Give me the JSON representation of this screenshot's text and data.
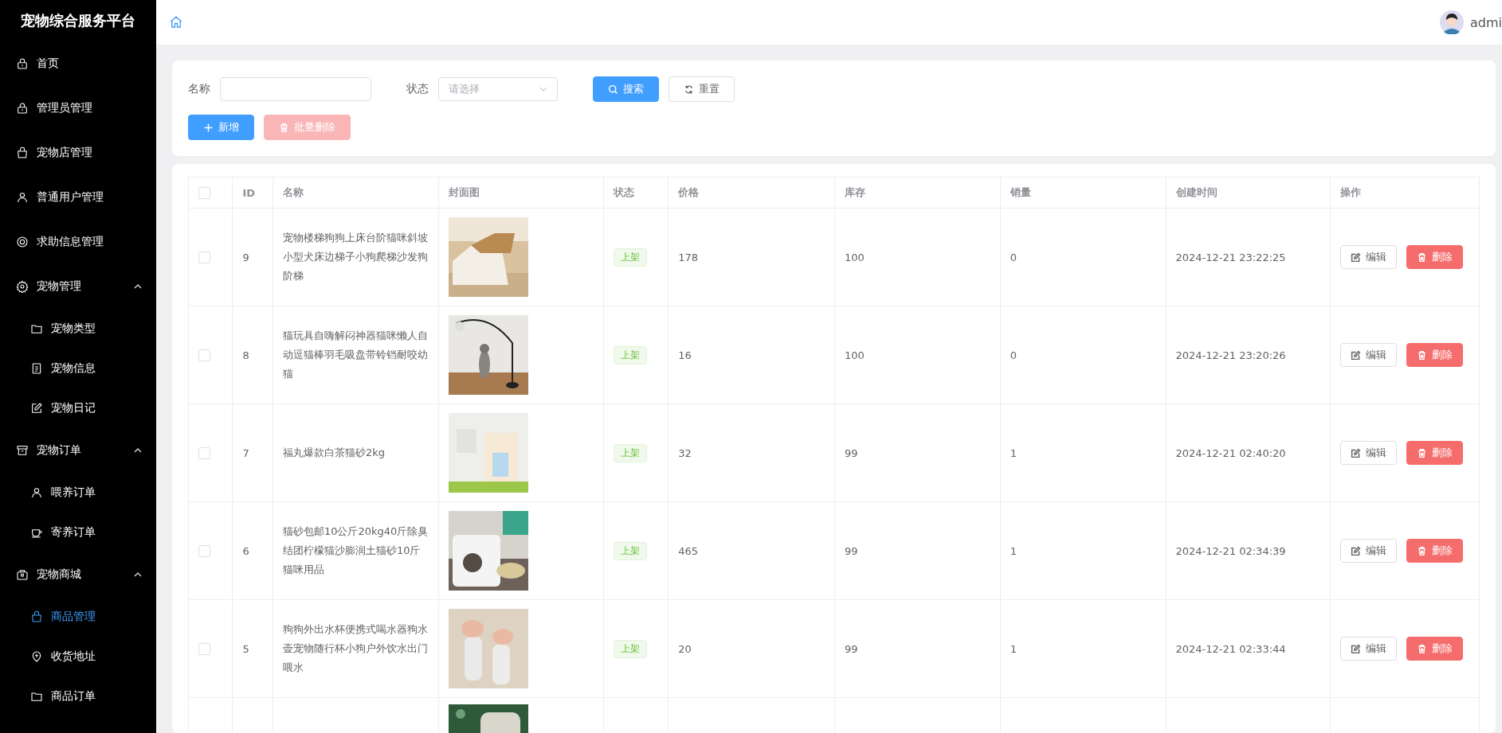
{
  "sidebar": {
    "title": "宠物综合服务平台",
    "items": [
      {
        "label": "首页",
        "selected": false
      },
      {
        "label": "管理员管理",
        "selected": false
      },
      {
        "label": "宠物店管理",
        "selected": false
      },
      {
        "label": "普通用户管理",
        "selected": false
      },
      {
        "label": "求助信息管理",
        "selected": false
      },
      {
        "label": "宠物管理",
        "selected": false,
        "expanded": true,
        "children": [
          {
            "label": "宠物类型",
            "selected": false
          },
          {
            "label": "宠物信息",
            "selected": false
          },
          {
            "label": "宠物日记",
            "selected": false
          }
        ]
      },
      {
        "label": "宠物订单",
        "selected": false,
        "expanded": true,
        "children": [
          {
            "label": "喂养订单",
            "selected": false
          },
          {
            "label": "寄养订单",
            "selected": false
          }
        ]
      },
      {
        "label": "宠物商城",
        "selected": false,
        "expanded": true,
        "children": [
          {
            "label": "商品管理",
            "selected": true
          },
          {
            "label": "收货地址",
            "selected": false
          },
          {
            "label": "商品订单",
            "selected": false
          }
        ]
      }
    ]
  },
  "header": {
    "user": "admi"
  },
  "filters": {
    "name_label": "名称",
    "status_label": "状态",
    "status_placeholder": "请选择",
    "search_button": "搜索",
    "reset_button": "重置",
    "add_button": "新增",
    "batch_delete_button": "批量删除",
    "batch_delete_disabled": true
  },
  "table": {
    "select_all_checked": false,
    "columns": [
      "ID",
      "名称",
      "封面图",
      "状态",
      "价格",
      "库存",
      "销量",
      "创建时间",
      "操作"
    ],
    "rows": [
      {
        "checked": false,
        "id": "9",
        "name": "宠物楼梯狗狗上床台阶猫咪斜坡小型犬床边梯子小狗爬梯沙发狗阶梯",
        "status": "上架",
        "price": "178",
        "stock": "100",
        "sales": "0",
        "created": "2024-12-21 23:22:25",
        "edit": "编辑",
        "delete": "删除"
      },
      {
        "checked": false,
        "id": "8",
        "name": "猫玩具自嗨解闷神器猫咪懒人自动逗猫棒羽毛吸盘带铃铛耐咬幼猫",
        "status": "上架",
        "price": "16",
        "stock": "100",
        "sales": "0",
        "created": "2024-12-21 23:20:26",
        "edit": "编辑",
        "delete": "删除"
      },
      {
        "checked": false,
        "id": "7",
        "name": "福丸爆款白茶猫砂2kg",
        "status": "上架",
        "price": "32",
        "stock": "99",
        "sales": "1",
        "created": "2024-12-21 02:40:20",
        "edit": "编辑",
        "delete": "删除"
      },
      {
        "checked": false,
        "id": "6",
        "name": "猫砂包邮10公斤20kg40斤除臭结团柠檬猫沙膨润土猫砂10斤猫咪用品",
        "status": "上架",
        "price": "465",
        "stock": "99",
        "sales": "1",
        "created": "2024-12-21 02:34:39",
        "edit": "编辑",
        "delete": "删除"
      },
      {
        "checked": false,
        "id": "5",
        "name": "狗狗外出水杯便携式喝水器狗水壶宠物随行杯小狗户外饮水出门喂水",
        "status": "上架",
        "price": "20",
        "stock": "99",
        "sales": "1",
        "created": "2024-12-21 02:33:44",
        "edit": "编辑",
        "delete": "删除"
      }
    ]
  }
}
